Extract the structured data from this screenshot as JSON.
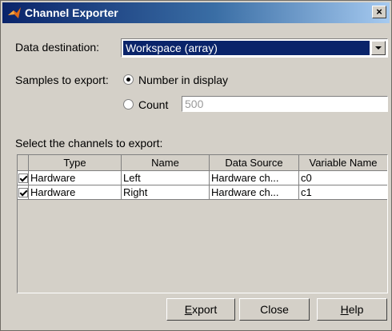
{
  "window": {
    "title": "Channel Exporter",
    "close_glyph": "×"
  },
  "destination": {
    "label": "Data destination:",
    "value": "Workspace (array)"
  },
  "samples": {
    "label": "Samples to export:",
    "option_display": "Number in display",
    "option_count": "Count",
    "count_value": "500",
    "selected": "display"
  },
  "channels": {
    "label": "Select the channels to export:",
    "columns": [
      "Type",
      "Name",
      "Data Source",
      "Variable Name"
    ],
    "rows": [
      {
        "checked": true,
        "type": "Hardware",
        "name": "Left",
        "source": "Hardware ch...",
        "variable": "c0"
      },
      {
        "checked": true,
        "type": "Hardware",
        "name": "Right",
        "source": "Hardware ch...",
        "variable": "c1"
      }
    ]
  },
  "buttons": {
    "export": {
      "mnemonic": "E",
      "rest": "xport"
    },
    "close": "Close",
    "help": {
      "mnemonic": "H",
      "rest": "elp"
    }
  },
  "colors": {
    "title_start": "#0a246a",
    "title_end": "#a6caf0",
    "face": "#d4d0c8",
    "selection": "#0a246a"
  }
}
